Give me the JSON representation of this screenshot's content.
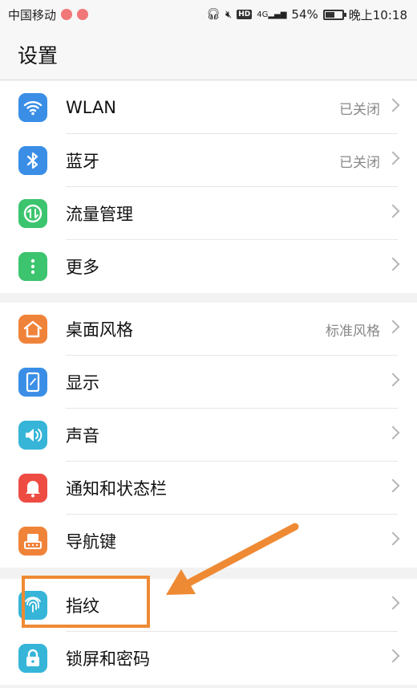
{
  "status_bar": {
    "carrier": "中国移动",
    "hd": "HD",
    "network": "4G",
    "battery": "54%",
    "battery_level": 0.54,
    "time": "晚上10:18"
  },
  "header": {
    "title": "设置"
  },
  "groups": [
    {
      "items": [
        {
          "label": "WLAN",
          "value": "已关闭",
          "icon": "wifi-icon",
          "color": "#3a8ee6"
        },
        {
          "label": "蓝牙",
          "value": "已关闭",
          "icon": "bluetooth-icon",
          "color": "#3a8ee6"
        },
        {
          "label": "流量管理",
          "value": "",
          "icon": "data-usage-icon",
          "color": "#3cc46e"
        },
        {
          "label": "更多",
          "value": "",
          "icon": "more-icon",
          "color": "#3cc46e"
        }
      ]
    },
    {
      "items": [
        {
          "label": "桌面风格",
          "value": "标准风格",
          "icon": "home-icon",
          "color": "#f0833a"
        },
        {
          "label": "显示",
          "value": "",
          "icon": "display-icon",
          "color": "#3a8ee6"
        },
        {
          "label": "声音",
          "value": "",
          "icon": "sound-icon",
          "color": "#36b5d8"
        },
        {
          "label": "通知和状态栏",
          "value": "",
          "icon": "bell-icon",
          "color": "#ee4c43"
        },
        {
          "label": "导航键",
          "value": "",
          "icon": "navigation-key-icon",
          "color": "#f0833a"
        }
      ]
    },
    {
      "items": [
        {
          "label": "指纹",
          "value": "",
          "icon": "fingerprint-icon",
          "color": "#36b5d8"
        },
        {
          "label": "锁屏和密码",
          "value": "",
          "icon": "lock-icon",
          "color": "#36b5d8"
        }
      ]
    }
  ],
  "annotation_color": "#ef8a34"
}
